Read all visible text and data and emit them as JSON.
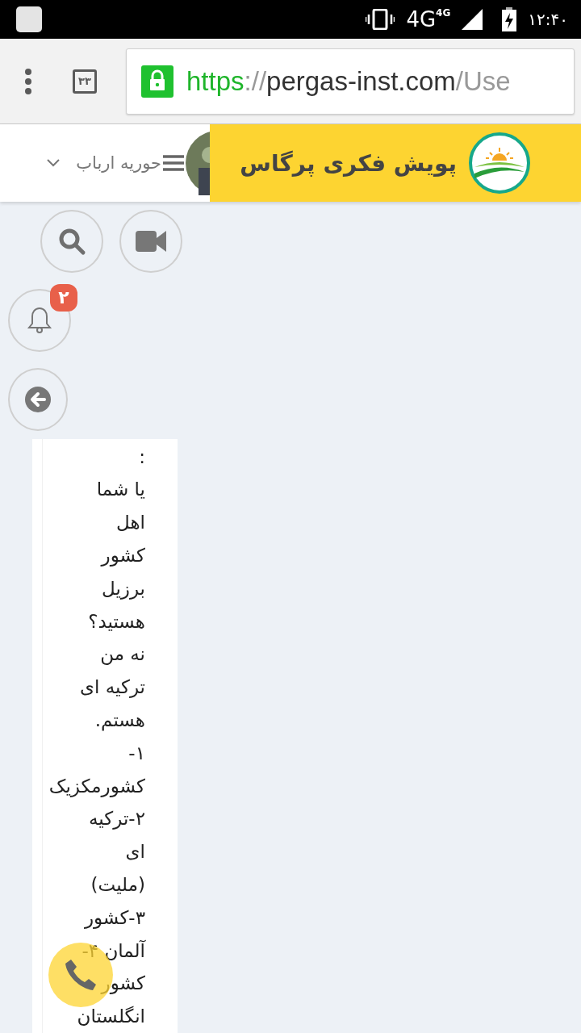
{
  "status_bar": {
    "network": "4G",
    "network_small": "4G",
    "time": "۱۲:۴۰"
  },
  "browser": {
    "tab_count": "۳۳",
    "url_scheme": "https",
    "url_sep": "://",
    "url_host": "pergas-inst.com",
    "url_path": "/Use"
  },
  "header": {
    "brand": "پویش فکری پرگاس",
    "user_name": "حوریه ارباب"
  },
  "actions": {
    "notification_count": "۲"
  },
  "message": {
    "lines": [
      ":",
      "یا شما",
      "اهل",
      "کشور",
      "برزیل",
      "هستید؟",
      "نه من",
      "ترکیه ای",
      "هستم.",
      "۱-",
      "کشورمکزیک",
      "۲-ترکیه",
      "ای",
      "(ملیت)",
      "۳-کشور",
      "آلمان ۴-",
      "کشور",
      "انگلستان"
    ]
  }
}
